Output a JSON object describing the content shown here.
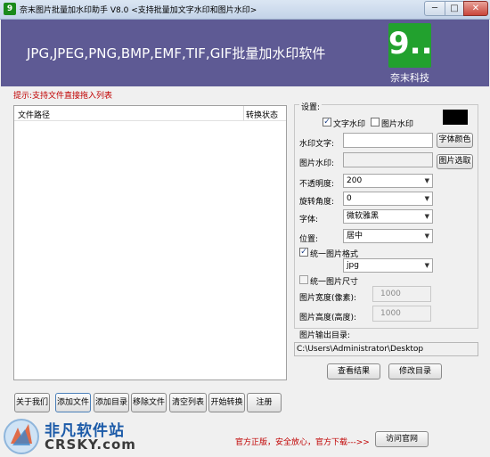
{
  "window": {
    "title": "奈末图片批量加水印助手 V8.0    <支持批量加文字水印和图片水印>",
    "icon_letter": "9",
    "minimize_glyph": "─",
    "maximize_glyph": "□",
    "close_glyph": "✕"
  },
  "banner": {
    "headline": "JPG,JPEG,PNG,BMP,EMF,TIF,GIF批量加水印软件",
    "logo_glyph": "9..",
    "logo_caption": "奈末科技"
  },
  "hint": "提示:支持文件直接拖入列表",
  "file_list": {
    "columns": [
      "文件路径",
      "转换状态"
    ],
    "rows": []
  },
  "settings": {
    "group_title": "设置:",
    "text_watermark_label": "文字水印",
    "text_watermark_checked": true,
    "image_watermark_label": "图片水印",
    "image_watermark_checked": false,
    "watermark_text_label": "水印文字:",
    "watermark_text_value": "",
    "font_color_button": "字体颜色",
    "font_color": "#000000",
    "image_watermark_field_label": "图片水印:",
    "image_select_button": "图片选取",
    "opacity_label": "不透明度:",
    "opacity_value": "200",
    "rotation_label": "旋转角度:",
    "rotation_value": "0",
    "font_label": "字体:",
    "font_value": "微软雅黑",
    "position_label": "位置:",
    "position_value": "居中",
    "unify_format_label": "统一图片格式",
    "unify_format_checked": true,
    "format_value": "jpg",
    "unify_size_label": "统一图片尺寸",
    "unify_size_checked": false,
    "width_label": "图片宽度(像素):",
    "width_value": "1000",
    "height_label": "图片高度(高度):",
    "height_value": "1000"
  },
  "output": {
    "label": "图片输出目录:",
    "path": "C:\\Users\\Administrator\\Desktop",
    "view_button": "查看结果",
    "change_button": "修改目录"
  },
  "toolbar": {
    "about": "关于我们",
    "add_file": "添加文件",
    "add_folder": "添加目录",
    "remove_file": "移除文件",
    "clear_list": "清空列表",
    "start": "开始转换",
    "register": "注册"
  },
  "footer": {
    "note": "官方正版，安全放心，官方下载--->>",
    "visit_button": "访问官网"
  },
  "watermark_overlay": {
    "name": "非凡软件站",
    "domain": "CRSKY.com"
  },
  "colors": {
    "banner": "#5e5a94",
    "logo_green": "#22a12e",
    "hint_red": "#c00000"
  }
}
